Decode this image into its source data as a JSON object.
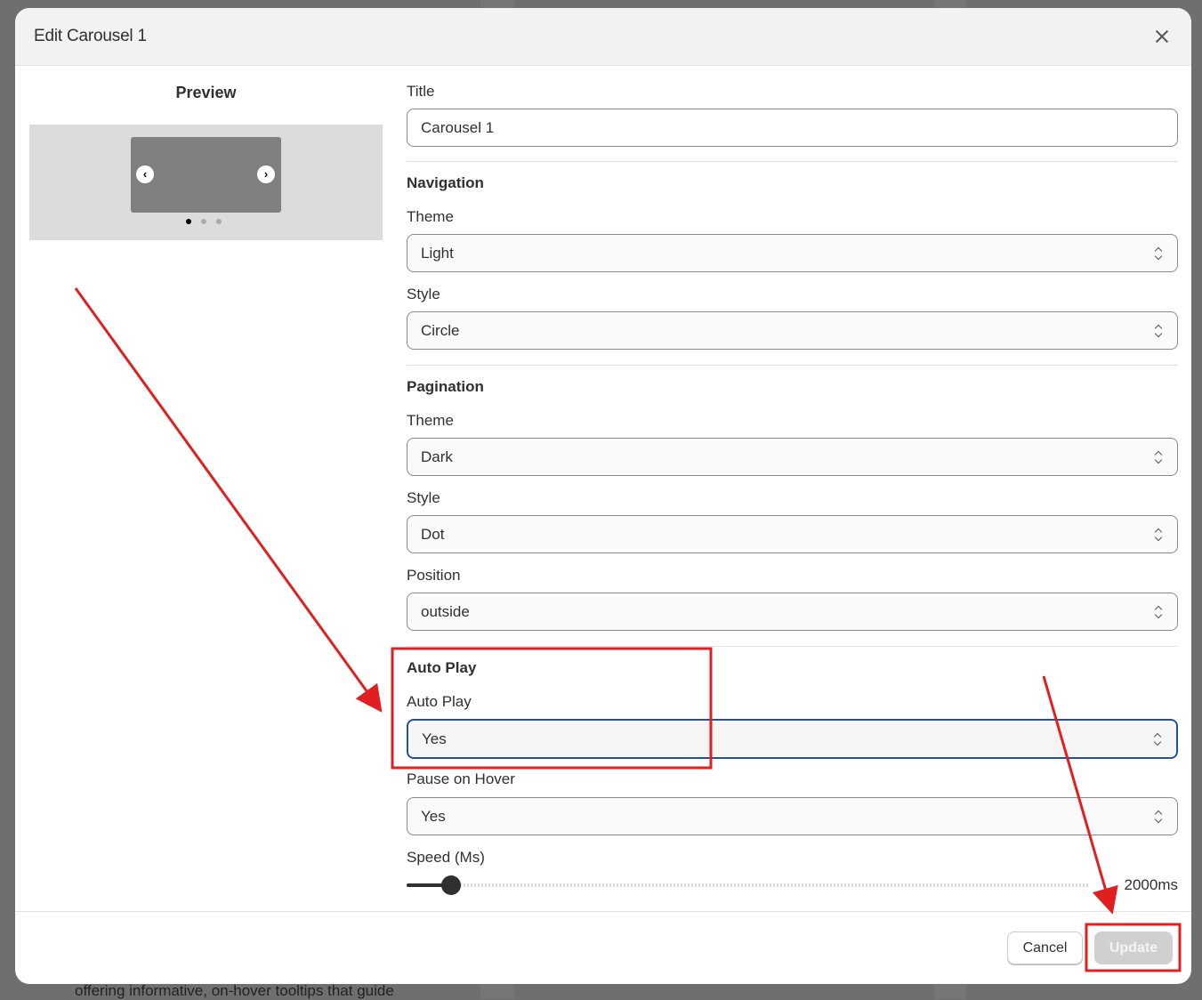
{
  "background": {
    "text": "offering informative, on-hover tooltips that guide"
  },
  "modal": {
    "title": "Edit Carousel 1",
    "close_icon": "close-icon",
    "preview": {
      "heading": "Preview",
      "dots": 3,
      "active_dot": 1
    },
    "form": {
      "title_label": "Title",
      "title_value": "Carousel 1",
      "navigation": {
        "heading": "Navigation",
        "theme_label": "Theme",
        "theme_value": "Light",
        "style_label": "Style",
        "style_value": "Circle"
      },
      "pagination": {
        "heading": "Pagination",
        "theme_label": "Theme",
        "theme_value": "Dark",
        "style_label": "Style",
        "style_value": "Dot",
        "position_label": "Position",
        "position_value": "outside"
      },
      "autoplay": {
        "heading": "Auto Play",
        "autoplay_label": "Auto Play",
        "autoplay_value": "Yes",
        "pause_label": "Pause on Hover",
        "pause_value": "Yes",
        "speed_label": "Speed (Ms)",
        "speed_value": "2000ms",
        "speed_fraction": 0.065
      }
    },
    "footer": {
      "cancel": "Cancel",
      "update": "Update"
    }
  },
  "annotation_color": "#e02020"
}
